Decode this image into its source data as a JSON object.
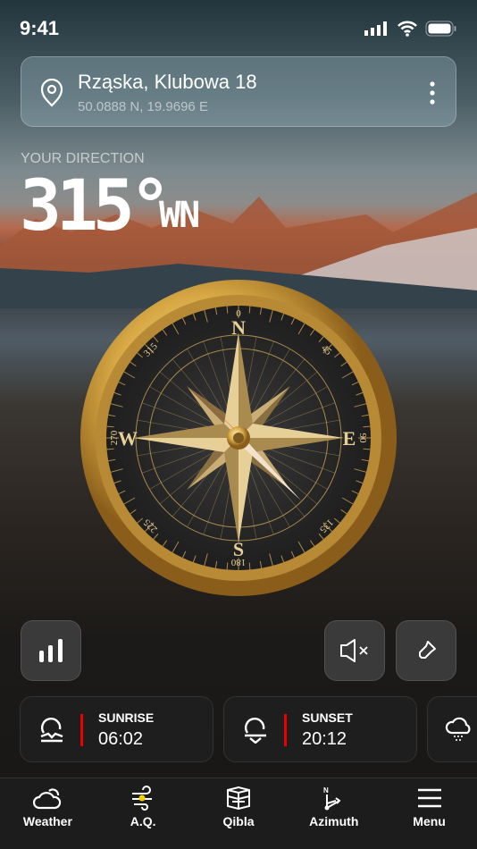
{
  "status": {
    "time": "9:41"
  },
  "location": {
    "name": "Rząska, Klubowa 18",
    "coords": "50.0888 N, 19.9696 E"
  },
  "direction": {
    "label": "YOUR DIRECTION",
    "degrees": "315°",
    "cardinal": "WN"
  },
  "compass": {
    "heading_deg": 315,
    "letters": {
      "n": "N",
      "e": "E",
      "s": "S",
      "w": "W"
    },
    "numbers": [
      "0",
      "45",
      "90",
      "135",
      "180",
      "225",
      "270",
      "315"
    ],
    "needle_color": "#e8112d",
    "gold": "#d4a94a"
  },
  "info_cards": [
    {
      "label": "SUNRISE",
      "value": "06:02",
      "icon": "sunrise-icon"
    },
    {
      "label": "SUNSET",
      "value": "20:12",
      "icon": "sunset-icon"
    }
  ],
  "accent": "#e00000",
  "nav": [
    {
      "label": "Weather"
    },
    {
      "label": "A.Q."
    },
    {
      "label": "Qibla"
    },
    {
      "label": "Azimuth"
    },
    {
      "label": "Menu"
    }
  ]
}
